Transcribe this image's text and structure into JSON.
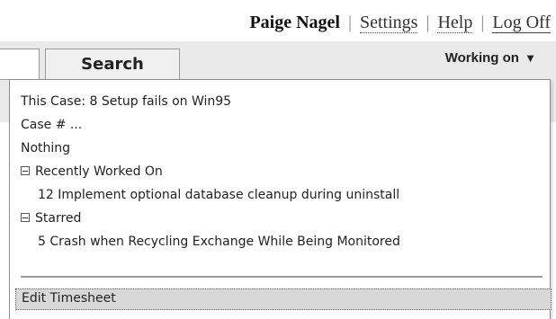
{
  "header": {
    "user_name": "Paige Nagel",
    "separator": "|",
    "settings_label": "Settings",
    "help_label": "Help",
    "logoff_label": "Log Off"
  },
  "toolbar": {
    "search_value": "",
    "search_button_label": "Search",
    "working_on_label": "Working on",
    "working_on_arrow": "▼"
  },
  "working_on_menu": {
    "this_case": "This Case: 8 Setup fails on Win95",
    "case_number": "Case # ...",
    "nothing": "Nothing",
    "recently_worked_on": {
      "label": "Recently Worked On",
      "items": [
        "12 Implement optional database cleanup during uninstall"
      ]
    },
    "starred": {
      "label": "Starred",
      "items": [
        "5 Crash when Recycling Exchange While Being Monitored"
      ]
    },
    "edit_timesheet": "Edit Timesheet"
  }
}
